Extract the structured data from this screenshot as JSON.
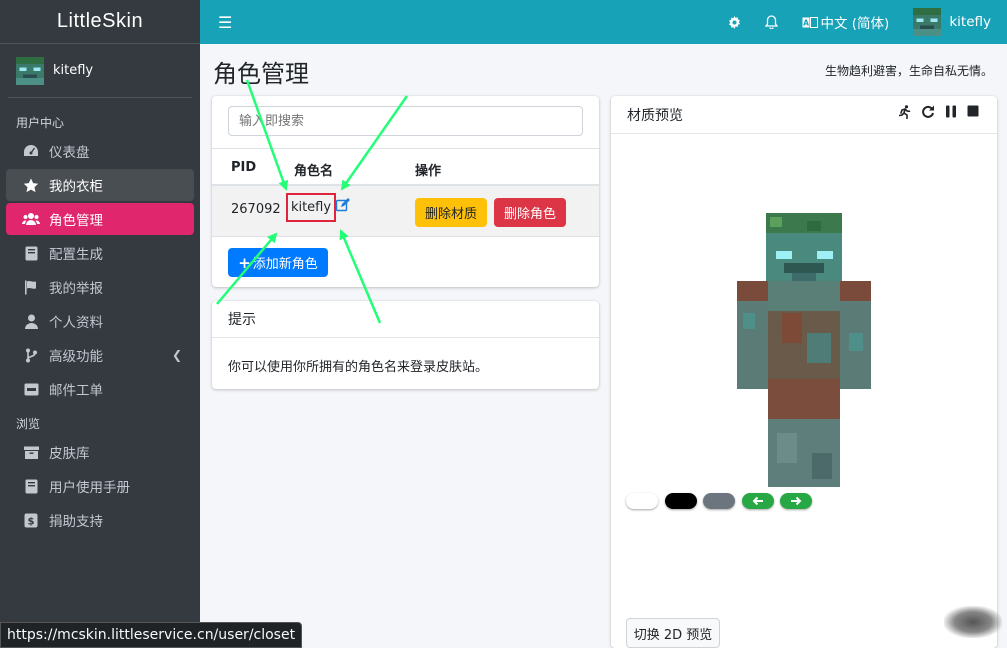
{
  "app": {
    "brand": "LittleSkin"
  },
  "sidebar": {
    "user": "kitefly",
    "sections": [
      {
        "header": "用户中心"
      },
      {
        "header": "浏览"
      }
    ],
    "items": [
      {
        "label": "仪表盘",
        "icon": "dashboard-icon"
      },
      {
        "label": "我的衣柜",
        "icon": "star-icon"
      },
      {
        "label": "角色管理",
        "icon": "users-icon"
      },
      {
        "label": "配置生成",
        "icon": "book-icon"
      },
      {
        "label": "我的举报",
        "icon": "flag-icon"
      },
      {
        "label": "个人资料",
        "icon": "user-icon"
      },
      {
        "label": "高级功能",
        "icon": "branch-icon"
      },
      {
        "label": "邮件工单",
        "icon": "server-icon"
      },
      {
        "label": "皮肤库",
        "icon": "archive-icon"
      },
      {
        "label": "用户使用手册",
        "icon": "manual-icon"
      },
      {
        "label": "捐助支持",
        "icon": "donate-icon"
      }
    ]
  },
  "topbar": {
    "menu_icon": "bars-icon",
    "settings_icon": "gear-icon",
    "bell_icon": "bell-icon",
    "language": "中文 (简体)",
    "username": "kitefly"
  },
  "page": {
    "title": "角色管理",
    "motto": "生物趋利避害，生命自私无情。"
  },
  "players": {
    "search_placeholder": "输入即搜索",
    "columns": [
      "PID",
      "角色名",
      "操作"
    ],
    "rows": [
      {
        "pid": "267092",
        "name": "kitefly",
        "delete_texture": "删除材质",
        "delete_player": "删除角色"
      }
    ],
    "add_button": "添加新角色"
  },
  "tips": {
    "title": "提示",
    "body": "你可以使用你所拥有的角色名来登录皮肤站。"
  },
  "preview": {
    "title": "材质预览",
    "toggle_button": "切换 2D 预览",
    "backgrounds": [
      "#ffffff",
      "#000000",
      "#6c757d"
    ]
  },
  "status_url": "https://mcskin.littleservice.cn/user/closet",
  "colors": {
    "sidebar": "#343a40",
    "topbar": "#17a2b8",
    "active": "#e0266c",
    "annotation_arrow": "#22ff77",
    "highlight_box": "#e0243b"
  }
}
